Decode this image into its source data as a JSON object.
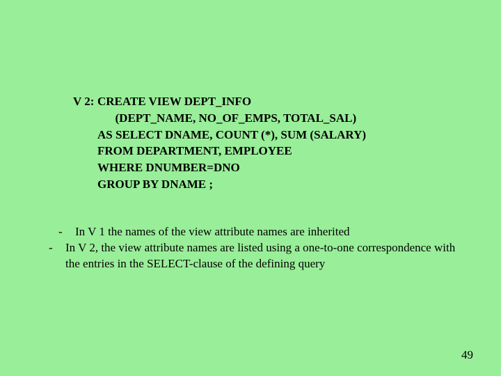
{
  "code": {
    "label": "V 2:",
    "line1": "CREATE VIEW   DEPT_INFO",
    "line2": "      (DEPT_NAME, NO_OF_EMPS, TOTAL_SAL)",
    "line3": "AS  SELECT DNAME, COUNT (*), SUM (SALARY)",
    "line4": "FROM   DEPARTMENT, EMPLOYEE",
    "line5": "WHERE DNUMBER=DNO",
    "line6": "GROUP BY DNAME ;"
  },
  "notes": {
    "dash": "-",
    "n1": "In V 1 the names of the view attribute names are inherited",
    "n2": "In V 2, the view attribute names are listed using a one-to-one correspondence with the entries in the SELECT-clause of the defining query"
  },
  "page": "49"
}
